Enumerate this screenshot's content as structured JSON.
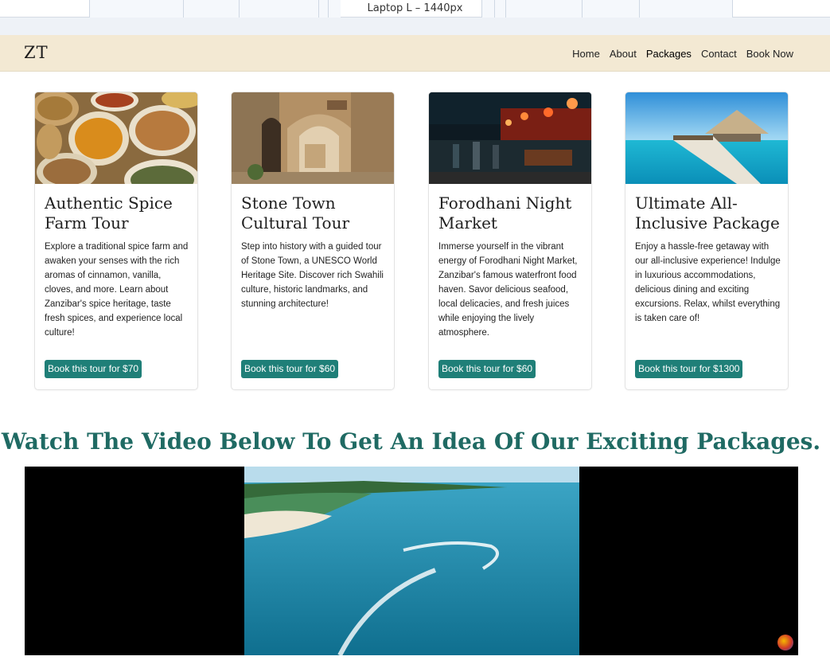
{
  "devtools": {
    "viewport_label": "Laptop L – 1440px"
  },
  "header": {
    "brand": "ZT",
    "nav": [
      "Home",
      "About",
      "Packages",
      "Contact",
      "Book Now"
    ]
  },
  "cards": [
    {
      "title": "Authentic Spice Farm Tour",
      "description": "Explore a traditional spice farm and awaken your senses with the rich aromas of cinnamon, vanilla, cloves, and more. Learn about Zanzibar's spice heritage, taste fresh spices, and experience local culture!",
      "button": "Book this tour for $70"
    },
    {
      "title": "Stone Town Cultural Tour",
      "description": "Step into history with a guided tour of Stone Town, a UNESCO World Heritage Site. Discover rich Swahili culture, historic landmarks, and stunning architecture!",
      "button": "Book this tour for $60"
    },
    {
      "title": "Forodhani Night Market",
      "description": "Immerse yourself in the vibrant energy of Forodhani Night Market, Zanzibar's famous waterfront food haven. Savor delicious seafood, local delicacies, and fresh juices while enjoying the lively atmosphere.",
      "button": "Book this tour for $60"
    },
    {
      "title": "Ultimate All-Inclusive Package",
      "description": "Enjoy a hassle-free getaway with our all-inclusive experience! Indulge in luxurious accommodations, delicious dining and exciting excursions. Relax, whilst everything is taken care of!",
      "button": "Book this tour for $1300"
    }
  ],
  "video_section": {
    "heading": "Watch The Video Below To Get An Idea Of Our Exciting Packages."
  },
  "colors": {
    "accent": "#1f7f78",
    "heading": "#1f6a63",
    "nav_bg": "#f3e9d3"
  }
}
